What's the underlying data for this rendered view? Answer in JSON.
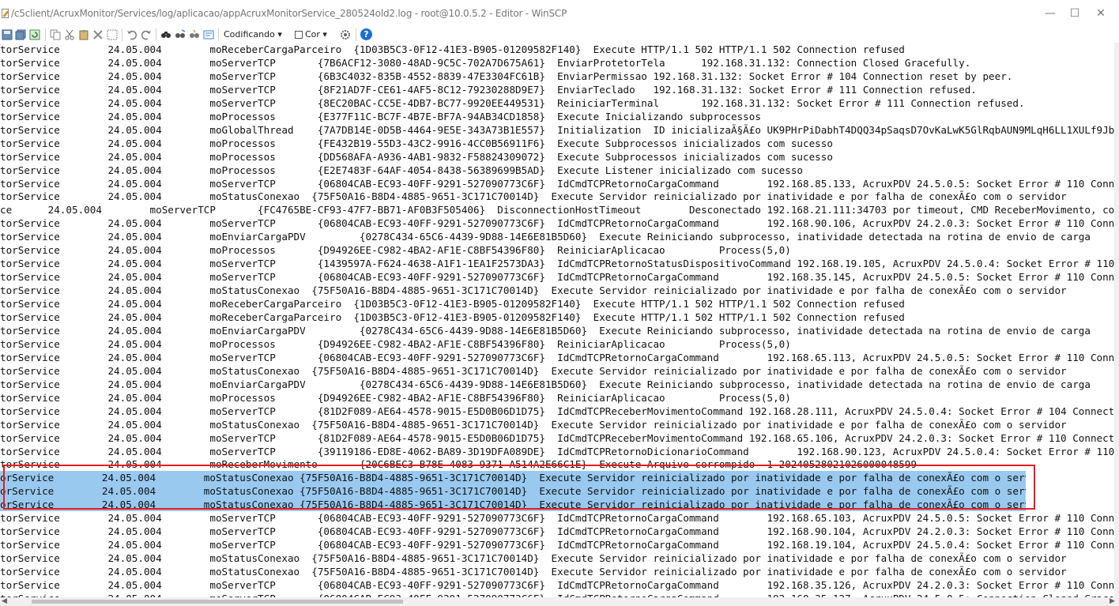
{
  "window": {
    "title": "/c5client/AcruxMonitor/Services/log/aplicacao/appAcruxMonitorService_280524old2.log - root@10.0.5.2 - Editor - WinSCP",
    "minimize_glyph": "—",
    "maximize_glyph": "☐",
    "close_glyph": "✕"
  },
  "toolbar": {
    "encoding_label": "Codificando ▾",
    "color_label": "Cor ▾",
    "help_glyph": "?"
  },
  "colors": {
    "selection": "#99c9ef",
    "highlight_box": "#ea1c1c",
    "help_icon": "#1f6fd6"
  },
  "editor": {
    "lines": [
      "torService        24.05.004        moReceberCargaParceiro  {1D03B5C3-0F12-41E3-B905-01209582F140}  Execute HTTP/1.1 502 HTTP/1.1 502 Connection refused",
      "torService        24.05.004        moServerTCP       {7B6ACF12-3080-48AD-9C5C-702A7D675A61}  EnviarProtetorTela      192.168.31.132: Connection Closed Gracefully.",
      "torService        24.05.004        moServerTCP       {6B3C4032-835B-4552-8839-47E3304FC61B}  EnviarPermissao 192.168.31.132: Socket Error # 104 Connection reset by peer.",
      "torService        24.05.004        moServerTCP       {8F21AD7F-CE61-4AF5-8C12-79230288D9E7}  EnviarTeclado   192.168.31.132: Socket Error # 111 Connection refused.",
      "torService        24.05.004        moServerTCP       {8EC20BAC-CC5E-4DB7-BC77-9920EE449531}  ReiniciarTerminal       192.168.31.132: Socket Error # 111 Connection refused.",
      "torService        24.05.004        moProcessos       {E377F11C-BC7F-4B7E-BF7A-94AB34CD1858}  Execute Inicializando subprocessos",
      "torService        24.05.004        moGlobalThread    {7A7DB14E-0D5B-4464-9E5E-343A73B1E557}  Initialization  ID inicializaÃ§Ã£o UK9PHrPiDabhT4DQQ34pSaqsD7OvKaLwK5GlRqbAUN9MLqH6LL1XULf9JbT5DcvHPb1l",
      "torService        24.05.004        moProcessos       {FE432B19-55D3-43C2-9916-4CC0B56911F6}  Execute Subprocessos inicializados com sucesso",
      "torService        24.05.004        moProcessos       {DD568AFA-A936-4AB1-9832-F58824309072}  Execute Subprocessos inicializados com sucesso",
      "torService        24.05.004        moProcessos       {E2E7483F-64AF-4054-8438-56389699B5AD}  Execute Listener inicializado com sucesso",
      "torService        24.05.004        moServerTCP       {06804CAB-EC93-40FF-9291-527090773C6F}  IdCmdTCPRetornoCargaCommand        192.168.85.133, AcruxPDV 24.5.0.5: Socket Error # 110 Connection timed",
      "torService        24.05.004        moStatusConexao  {75F50A16-B8D4-4885-9651-3C171C70014D}  Execute Servidor reinicializado por inatividade e por falha de conexÃ£o com o servidor",
      "ce      24.05.004        moServerTCP       {FC4765BE-CF93-47F7-BB71-AF0B3F505406}  DisconnectionHostTimeout        Desconectado 192.168.21.111:34703 por timeout, CMD ReceberMovimento, conectado",
      "torService        24.05.004        moServerTCP       {06804CAB-EC93-40FF-9291-527090773C6F}  IdCmdTCPRetornoCargaCommand        192.168.90.106, AcruxPDV 24.2.0.3: Socket Error # 110 Connection timed",
      "torService        24.05.004        moEnviarCargaPDV         {0278C434-65C6-4439-9D88-14E6E81B5D60}  Execute Reiniciando subprocesso, inatividade detectada na rotina de envio de carga",
      "torService        24.05.004        moProcessos       {D94926EE-C982-4BA2-AF1E-C8BF54396F80}  ReiniciarAplicacao         Process(5,0)",
      "torService        24.05.004        moServerTCP       {1439597A-F624-4638-A1F1-1EA1F2573DA3}  IdCmdTCPRetornoStatusDispositivoCommand 192.168.19.105, AcruxPDV 24.5.0.4: Socket Error # 110 Connecti",
      "torService        24.05.004        moServerTCP       {06804CAB-EC93-40FF-9291-527090773C6F}  IdCmdTCPRetornoCargaCommand        192.168.35.145, AcruxPDV 24.5.0.5: Socket Error # 110 Connection timed",
      "torService        24.05.004        moStatusConexao  {75F50A16-B8D4-4885-9651-3C171C70014D}  Execute Servidor reinicializado por inatividade e por falha de conexÃ£o com o servidor",
      "torService        24.05.004        moReceberCargaParceiro  {1D03B5C3-0F12-41E3-B905-01209582F140}  Execute HTTP/1.1 502 HTTP/1.1 502 Connection refused",
      "torService        24.05.004        moReceberCargaParceiro  {1D03B5C3-0F12-41E3-B905-01209582F140}  Execute HTTP/1.1 502 HTTP/1.1 502 Connection refused",
      "torService        24.05.004        moEnviarCargaPDV         {0278C434-65C6-4439-9D88-14E6E81B5D60}  Execute Reiniciando subprocesso, inatividade detectada na rotina de envio de carga",
      "torService        24.05.004        moProcessos       {D94926EE-C982-4BA2-AF1E-C8BF54396F80}  ReiniciarAplicacao         Process(5,0)",
      "torService        24.05.004        moServerTCP       {06804CAB-EC93-40FF-9291-527090773C6F}  IdCmdTCPRetornoCargaCommand        192.168.65.113, AcruxPDV 24.5.0.5: Socket Error # 110 Connection timed",
      "torService        24.05.004        moStatusConexao  {75F50A16-B8D4-4885-9651-3C171C70014D}  Execute Servidor reinicializado por inatividade e por falha de conexÃ£o com o servidor",
      "torService        24.05.004        moEnviarCargaPDV         {0278C434-65C6-4439-9D88-14E6E81B5D60}  Execute Reiniciando subprocesso, inatividade detectada na rotina de envio de carga",
      "torService        24.05.004        moProcessos       {D94926EE-C982-4BA2-AF1E-C8BF54396F80}  ReiniciarAplicacao         Process(5,0)",
      "torService        24.05.004        moServerTCP       {81D2F089-AE64-4578-9015-E5D0B06D1D75}  IdCmdTCPReceberMovimentoCommand 192.168.28.111, AcruxPDV 24.5.0.4: Socket Error # 104 Connection reset",
      "torService        24.05.004        moStatusConexao  {75F50A16-B8D4-4885-9651-3C171C70014D}  Execute Servidor reinicializado por inatividade e por falha de conexÃ£o com o servidor",
      "torService        24.05.004        moServerTCP       {81D2F089-AE64-4578-9015-E5D0B06D1D75}  IdCmdTCPReceberMovimentoCommand 192.168.65.106, AcruxPDV 24.2.0.3: Socket Error # 110 Connection timed",
      "torService        24.05.004        moServerTCP       {39119186-ED8E-4062-BA89-3D19DFA089DE}  IdCmdTCPRetornoDicionarioCommand        192.168.90.123, AcruxPDV 24.5.0.4: Socket Error # 110 Connecti",
      "torService        24.05.004        moReceberMovimento       {20C6BEC3-B78E-4083-9371-A514A2E66C1E}  Execute Arquivo corrompido -1 20240528021026000048599",
      "orService        24.05.004        moStatusConexao {75F50A16-B8D4-4885-9651-3C171C70014D}  Execute Servidor reinicializado por inatividade e por falha de conexÃ£o com o servidor",
      "orService        24.05.004        moStatusConexao {75F50A16-B8D4-4885-9651-3C171C70014D}  Execute Servidor reinicializado por inatividade e por falha de conexÃ£o com o servidor",
      "orService        24.05.004        moStatusConexao {75F50A16-B8D4-4885-9651-3C171C70014D}  Execute Servidor reinicializado por inatividade e por falha de conexÃ£o com o servidor",
      "torService        24.05.004        moServerTCP       {06804CAB-EC93-40FF-9291-527090773C6F}  IdCmdTCPRetornoCargaCommand        192.168.65.103, AcruxPDV 24.5.0.5: Socket Error # 110 Connection timed",
      "torService        24.05.004        moServerTCP       {06804CAB-EC93-40FF-9291-527090773C6F}  IdCmdTCPRetornoCargaCommand        192.168.90.104, AcruxPDV 24.2.0.3: Socket Error # 110 Connection timed",
      "torService        24.05.004        moServerTCP       {06804CAB-EC93-40FF-9291-527090773C6F}  IdCmdTCPRetornoCargaCommand        192.168.19.104, AcruxPDV 24.5.0.4: Socket Error # 110 Connection timed",
      "torService        24.05.004        moStatusConexao  {75F50A16-B8D4-4885-9651-3C171C70014D}  Execute Servidor reinicializado por inatividade e por falha de conexÃ£o com o servidor",
      "torService        24.05.004        moStatusConexao  {75F50A16-B8D4-4885-9651-3C171C70014D}  Execute Servidor reinicializado por inatividade e por falha de conexÃ£o com o servidor",
      "torService        24.05.004        moServerTCP       {06804CAB-EC93-40FF-9291-527090773C6F}  IdCmdTCPRetornoCargaCommand        192.168.35.126, AcruxPDV 24.2.0.3: Socket Error # 110 Connection timed",
      "torService        24.05.004        moServerTCP       {06804CAB-EC93-40FF-9291-527090773C6F}  IdCmdTCPRetornoCargaCommand        192.168.35.127, AcruxPDV 24.5.0.5: Connection Closed Gracefully."
    ],
    "selected_lines": [
      32,
      33,
      34
    ]
  }
}
